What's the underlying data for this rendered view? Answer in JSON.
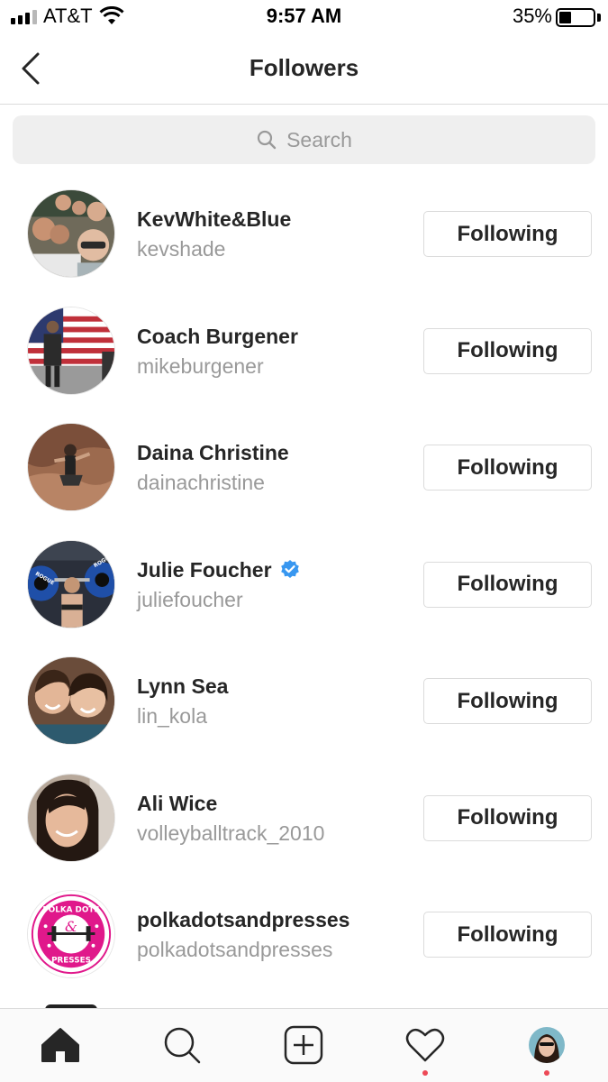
{
  "status_bar": {
    "carrier": "AT&T",
    "time": "9:57 AM",
    "battery_percent": "35%",
    "battery_level": 0.35,
    "signal_bars": 3
  },
  "header": {
    "title": "Followers",
    "back_icon": "chevron-left-icon"
  },
  "search": {
    "placeholder": "Search",
    "icon": "search-icon"
  },
  "followers": [
    {
      "display_name": "KevWhite&Blue",
      "username": "kevshade",
      "verified": false,
      "button_label": "Following"
    },
    {
      "display_name": "Coach Burgener",
      "username": "mikeburgener",
      "verified": false,
      "button_label": "Following"
    },
    {
      "display_name": "Daina Christine",
      "username": "dainachristine",
      "verified": false,
      "button_label": "Following"
    },
    {
      "display_name": "Julie Foucher",
      "username": "juliefoucher",
      "verified": true,
      "button_label": "Following"
    },
    {
      "display_name": "Lynn Sea",
      "username": "lin_kola",
      "verified": false,
      "button_label": "Following"
    },
    {
      "display_name": "Ali Wice",
      "username": "volleyballtrack_2010",
      "verified": false,
      "button_label": "Following"
    },
    {
      "display_name": "polkadotsandpresses",
      "username": "polkadotsandpresses",
      "verified": false,
      "button_label": "Following"
    }
  ],
  "logo_text": {
    "polka_dots_top": "POLKA DOTS",
    "polka_dots_bottom": "PRESSES",
    "rogue": "ROGUE"
  },
  "tab_bar": {
    "tabs": [
      {
        "icon": "home-icon",
        "active": true,
        "notification": false
      },
      {
        "icon": "search-icon",
        "active": false,
        "notification": false
      },
      {
        "icon": "add-post-icon",
        "active": false,
        "notification": false
      },
      {
        "icon": "heart-icon",
        "active": false,
        "notification": true
      },
      {
        "icon": "profile-avatar-icon",
        "active": false,
        "notification": true
      }
    ]
  },
  "colors": {
    "text_primary": "#262626",
    "text_secondary": "#999999",
    "border": "#dbdbdb",
    "search_bg": "#efefef",
    "verified_blue": "#3897f0",
    "notification_red": "#ed4956",
    "polka_pink": "#e0188b"
  }
}
